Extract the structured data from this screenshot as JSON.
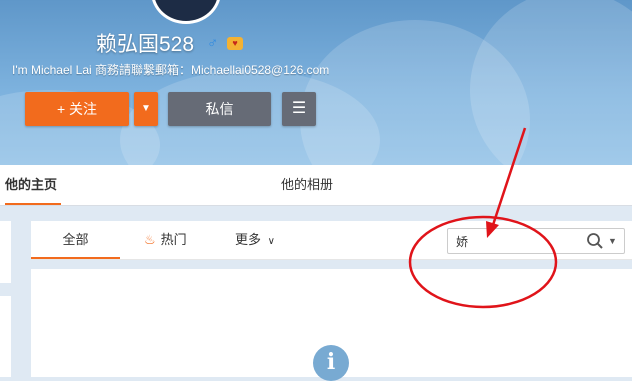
{
  "profile": {
    "name": "赖弘国528",
    "gender_icon": "male-icon",
    "vip_icon": "vip-badge-icon",
    "bio": "I'm Michael Lai 商務請聯繫郵箱：Michaellai0528@126.com"
  },
  "actions": {
    "follow_label": "+ 关注",
    "message_label": "私信",
    "menu_icon": "menu-icon"
  },
  "nav": {
    "tabs": [
      "他的主页",
      "他的相册"
    ],
    "active": "他的主页"
  },
  "filter": {
    "all_label": "全部",
    "hot_label": "热门",
    "more_label": "更多",
    "search_value": "娇"
  },
  "colors": {
    "accent": "#f26b1d",
    "header": "#7db2de",
    "annotation": "#e0141a"
  }
}
